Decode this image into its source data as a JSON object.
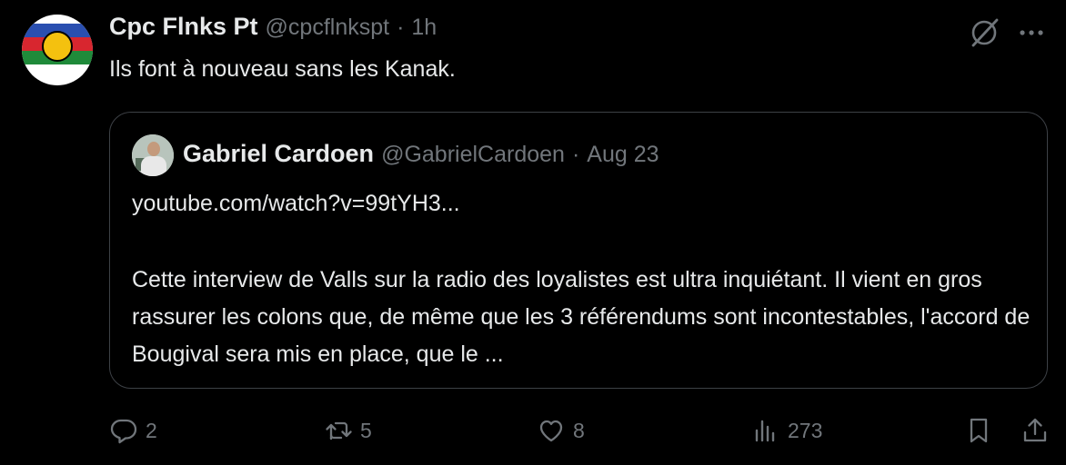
{
  "tweet": {
    "author_name": "Cpc Flnks Pt",
    "author_handle": "@cpcflnkspt",
    "separator": "·",
    "time": "1h",
    "text": "Ils font à nouveau sans les Kanak."
  },
  "quote": {
    "author_name": "Gabriel Cardoen",
    "author_handle": "@GabrielCardoen",
    "separator": "·",
    "time": "Aug 23",
    "link": "youtube.com/watch?v=99tYH3...",
    "body": "Cette interview de Valls sur la radio des loyalistes est  ultra inquiétant. Il vient en gros rassurer les colons que, de même que les 3 référendums sont incontestables, l'accord de Bougival sera mis en place, que le ..."
  },
  "actions": {
    "reply_count": "2",
    "retweet_count": "5",
    "like_count": "8",
    "views_count": "273"
  },
  "icons": {
    "top_right": [
      "grok-icon",
      "more-icon"
    ],
    "actions": [
      "reply-icon",
      "retweet-icon",
      "like-icon",
      "views-icon",
      "bookmark-icon",
      "share-icon"
    ]
  },
  "colors": {
    "background": "#000000",
    "text_primary": "#e7e9ea",
    "text_secondary": "#71767b",
    "border": "#3d4146"
  }
}
